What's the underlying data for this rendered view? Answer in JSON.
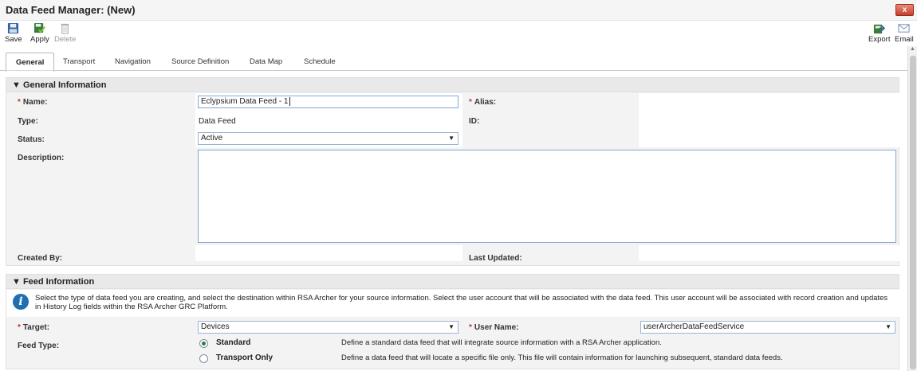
{
  "window": {
    "title": "Data Feed Manager: (New)",
    "close_label": "x"
  },
  "toolbar": {
    "save_label": "Save",
    "apply_label": "Apply",
    "delete_label": "Delete",
    "export_label": "Export",
    "email_label": "Email"
  },
  "tabs": [
    {
      "label": "General",
      "active": true
    },
    {
      "label": "Transport"
    },
    {
      "label": "Navigation"
    },
    {
      "label": "Source Definition"
    },
    {
      "label": "Data Map"
    },
    {
      "label": "Schedule"
    }
  ],
  "general_info": {
    "header": "▼ General Information",
    "name_label": "Name:",
    "name_value": "Eclypsium Data Feed - 1",
    "alias_label": "Alias:",
    "type_label": "Type:",
    "type_value": "Data Feed",
    "id_label": "ID:",
    "status_label": "Status:",
    "status_value": "Active",
    "description_label": "Description:",
    "created_by_label": "Created By:",
    "last_updated_label": "Last Updated:"
  },
  "feed_info": {
    "header": "▼ Feed Information",
    "info_line1": "Select the type of data feed you are creating, and select the destination within RSA Archer for your source information. Select the user account that will be associated with the data feed. This user account will be associated with record creation and updates",
    "info_line2": "in History Log fields within the RSA Archer GRC Platform.",
    "target_label": "Target:",
    "target_value": "Devices",
    "user_name_label": "User Name:",
    "user_name_value": "userArcherDataFeedService",
    "feed_type_label": "Feed Type:",
    "feed_types": [
      {
        "label": "Standard",
        "checked": true,
        "description": "Define a standard data feed that will integrate source information with a RSA Archer application."
      },
      {
        "label": "Transport Only",
        "checked": false,
        "description": "Define a data feed that will locate a specific file only. This file will contain information for launching subsequent, standard data feeds."
      }
    ]
  },
  "icons": {
    "save": "save-icon",
    "apply": "apply-icon",
    "delete": "delete-icon",
    "export": "export-icon",
    "email": "email-icon",
    "info": "info-icon",
    "dropdown": "chevron-down-icon"
  },
  "colors": {
    "required": "#c0392b",
    "close": "#c6402c",
    "info": "#1f6fb3",
    "radio_checked": "#2d7d3a"
  }
}
